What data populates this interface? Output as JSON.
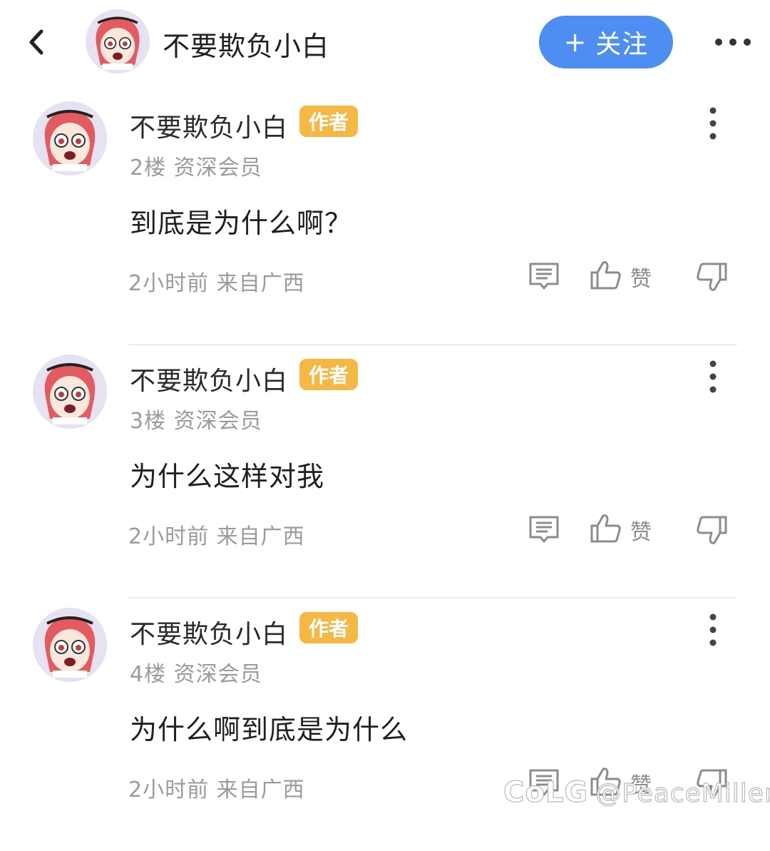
{
  "header": {
    "back_icon": "chevron-left-icon",
    "title": "不要欺负小白",
    "follow_plus": "+",
    "follow_label": "关注",
    "more_icon": "more-horizontal-icon",
    "accent": "#4e8ef2"
  },
  "posts": [
    {
      "name": "不要欺负小白",
      "badge": "作者",
      "meta": "2楼 资深会员",
      "content": "到底是为什么啊？",
      "time": "2小时前 来自广西",
      "like_label": "赞"
    },
    {
      "name": "不要欺负小白",
      "badge": "作者",
      "meta": "3楼 资深会员",
      "content": "为什么这样对我",
      "time": "2小时前 来自广西",
      "like_label": "赞"
    },
    {
      "name": "不要欺负小白",
      "badge": "作者",
      "meta": "4楼 资深会员",
      "content": "为什么啊到底是为什么",
      "time": "2小时前 来自广西",
      "like_label": "赞"
    }
  ],
  "badge_color": "#f6b844",
  "watermark": {
    "logo": "CoLG",
    "handle": "@PeaceMiller"
  }
}
